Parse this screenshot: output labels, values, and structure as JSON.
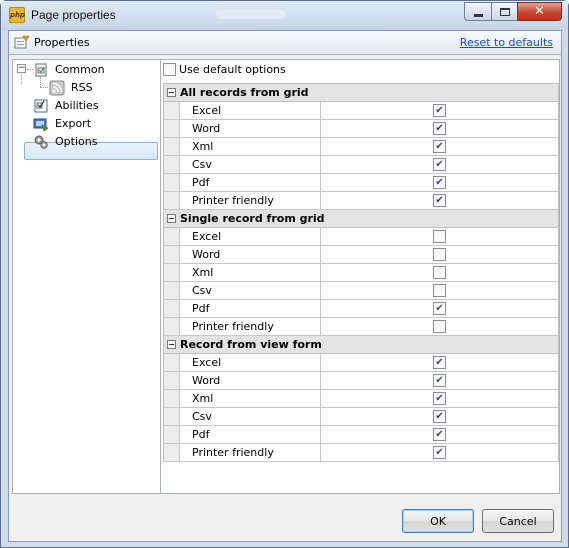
{
  "window": {
    "title": "Page properties",
    "app_icon_text": "php"
  },
  "header": {
    "title": "Properties",
    "reset_link": "Reset to defaults"
  },
  "tree": {
    "nodes": [
      {
        "label": "Common",
        "icon": "page-icon",
        "expanded": true
      },
      {
        "label": "RSS",
        "icon": "rss-icon"
      },
      {
        "label": "Abilities",
        "icon": "checklist-icon"
      },
      {
        "label": "Export",
        "icon": "export-icon",
        "selected": true
      },
      {
        "label": "Options",
        "icon": "gears-icon"
      }
    ]
  },
  "use_default": {
    "label": "Use default options",
    "checked": false
  },
  "groups": [
    {
      "title": "All records from grid",
      "rows": [
        {
          "name": "Excel",
          "checked": true
        },
        {
          "name": "Word",
          "checked": true
        },
        {
          "name": "Xml",
          "checked": true
        },
        {
          "name": "Csv",
          "checked": true
        },
        {
          "name": "Pdf",
          "checked": true
        },
        {
          "name": "Printer friendly",
          "checked": true
        }
      ]
    },
    {
      "title": "Single record from grid",
      "rows": [
        {
          "name": "Excel",
          "checked": false
        },
        {
          "name": "Word",
          "checked": false
        },
        {
          "name": "Xml",
          "checked": false
        },
        {
          "name": "Csv",
          "checked": false
        },
        {
          "name": "Pdf",
          "checked": true
        },
        {
          "name": "Printer friendly",
          "checked": false
        }
      ]
    },
    {
      "title": "Record from view form",
      "rows": [
        {
          "name": "Excel",
          "checked": true
        },
        {
          "name": "Word",
          "checked": true
        },
        {
          "name": "Xml",
          "checked": true
        },
        {
          "name": "Csv",
          "checked": true
        },
        {
          "name": "Pdf",
          "checked": true
        },
        {
          "name": "Printer friendly",
          "checked": true
        }
      ]
    }
  ],
  "buttons": {
    "ok": "OK",
    "cancel": "Cancel"
  },
  "colors": {
    "link": "#1a4ec8",
    "selection_border": "#8cb6e0",
    "close_button": "#c8452d"
  }
}
